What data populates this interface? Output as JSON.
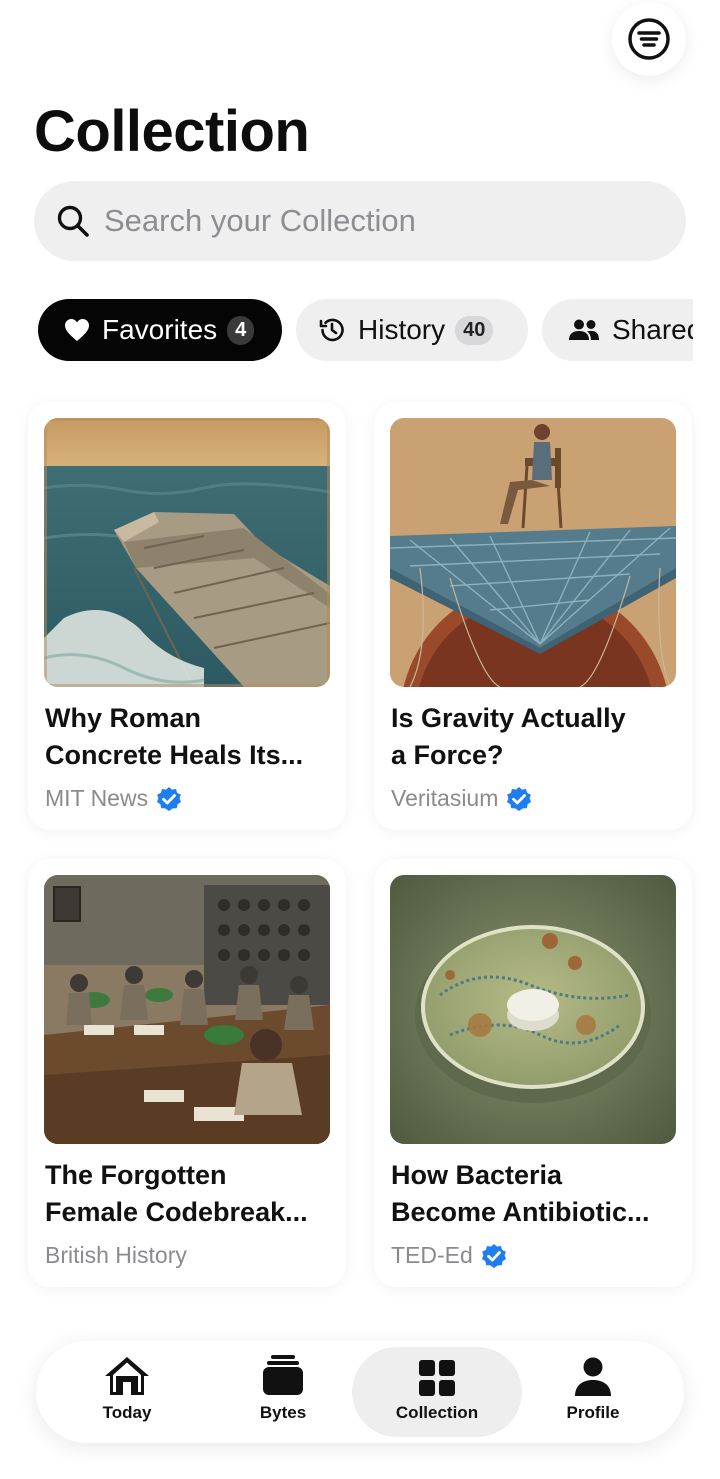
{
  "header": {
    "title": "Collection",
    "menu_icon": "menu-lines-icon"
  },
  "search": {
    "placeholder": "Search your Collection",
    "icon": "search-icon"
  },
  "tabs": [
    {
      "label": "Favorites",
      "count": "4",
      "icon": "heart-icon",
      "active": true
    },
    {
      "label": "History",
      "count": "40",
      "icon": "history-icon",
      "active": false
    },
    {
      "label": "Shared",
      "icon": "people-icon",
      "active": false
    }
  ],
  "cards": [
    {
      "title": "Why Roman\nConcrete Heals Its...",
      "source": "MIT News",
      "verified": true,
      "image": "roman-pier-painting"
    },
    {
      "title": "Is Gravity Actually\na Force?",
      "source": "Veritasium",
      "verified": true,
      "image": "spacetime-grid-painting"
    },
    {
      "title": "The Forgotten\nFemale Codebreak...",
      "source": "British History",
      "verified": false,
      "image": "codebreakers-room-painting"
    },
    {
      "title": "How Bacteria\nBecome Antibiotic...",
      "source": "TED-Ed",
      "verified": true,
      "image": "petri-dish-painting"
    }
  ],
  "nav": [
    {
      "label": "Today",
      "icon": "home-icon",
      "active": false
    },
    {
      "label": "Bytes",
      "icon": "stack-icon",
      "active": false
    },
    {
      "label": "Collection",
      "icon": "grid-icon",
      "active": true
    },
    {
      "label": "Profile",
      "icon": "person-icon",
      "active": false
    }
  ],
  "colors": {
    "accent": "#050505",
    "verified": "#1e7ef0",
    "chip_bg": "#efeff0"
  }
}
